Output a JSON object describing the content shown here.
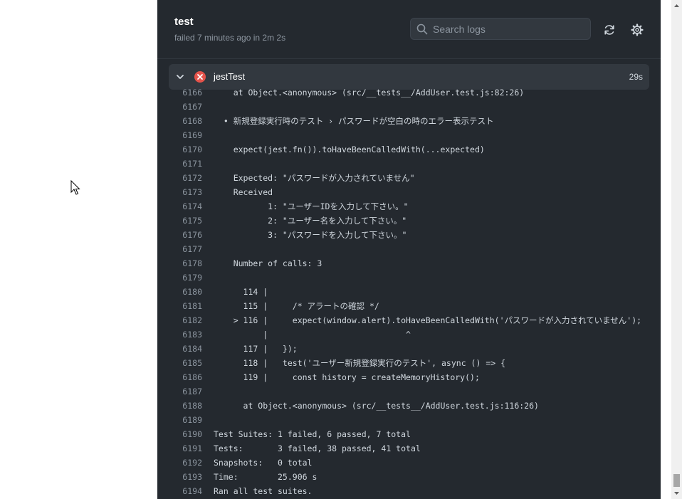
{
  "header": {
    "title": "test",
    "status": "failed 7 minutes ago in 2m 2s"
  },
  "search": {
    "placeholder": "Search logs"
  },
  "icons": {
    "search": "search-icon",
    "refresh": "refresh-icon",
    "settings": "gear-icon",
    "chevron": "chevron-down-icon",
    "fail": "x-circle-icon",
    "cursor": "mouse-pointer-icon"
  },
  "colors": {
    "panel_bg": "#24292f",
    "step_bg": "#32383f",
    "fail_red": "#e5534b",
    "line_number": "#8c959f",
    "log_text": "#d0d7de"
  },
  "step": {
    "name": "jestTest",
    "duration": "29s"
  },
  "log_lines": [
    {
      "num": "6166",
      "text": "    at Object.<anonymous> (src/__tests__/AddUser.test.js:82:26)"
    },
    {
      "num": "6167",
      "text": ""
    },
    {
      "num": "6168",
      "text": "  • 新規登録実行時のテスト › パスワードが空白の時のエラー表示テスト"
    },
    {
      "num": "6169",
      "text": ""
    },
    {
      "num": "6170",
      "text": "    expect(jest.fn()).toHaveBeenCalledWith(...expected)"
    },
    {
      "num": "6171",
      "text": ""
    },
    {
      "num": "6172",
      "text": "    Expected: \"パスワードが入力されていません\""
    },
    {
      "num": "6173",
      "text": "    Received"
    },
    {
      "num": "6174",
      "text": "           1: \"ユーザーIDを入力して下さい。\""
    },
    {
      "num": "6175",
      "text": "           2: \"ユーザー名を入力して下さい。\""
    },
    {
      "num": "6176",
      "text": "           3: \"パスワードを入力して下さい。\""
    },
    {
      "num": "6177",
      "text": ""
    },
    {
      "num": "6178",
      "text": "    Number of calls: 3"
    },
    {
      "num": "6179",
      "text": ""
    },
    {
      "num": "6180",
      "text": "      114 |"
    },
    {
      "num": "6181",
      "text": "      115 |     /* アラートの確認 */"
    },
    {
      "num": "6182",
      "text": "    > 116 |     expect(window.alert).toHaveBeenCalledWith('パスワードが入力されていません');"
    },
    {
      "num": "6183",
      "text": "          |                            ^"
    },
    {
      "num": "6184",
      "text": "      117 |   });"
    },
    {
      "num": "6185",
      "text": "      118 |   test('ユーザー新規登録実行のテスト', async () => {"
    },
    {
      "num": "6186",
      "text": "      119 |     const history = createMemoryHistory();"
    },
    {
      "num": "6187",
      "text": ""
    },
    {
      "num": "6188",
      "text": "      at Object.<anonymous> (src/__tests__/AddUser.test.js:116:26)"
    },
    {
      "num": "6189",
      "text": ""
    },
    {
      "num": "6190",
      "text": "Test Suites: 1 failed, 6 passed, 7 total"
    },
    {
      "num": "6191",
      "text": "Tests:       3 failed, 38 passed, 41 total"
    },
    {
      "num": "6192",
      "text": "Snapshots:   0 total"
    },
    {
      "num": "6193",
      "text": "Time:        25.906 s"
    },
    {
      "num": "6194",
      "text": "Ran all test suites."
    }
  ]
}
